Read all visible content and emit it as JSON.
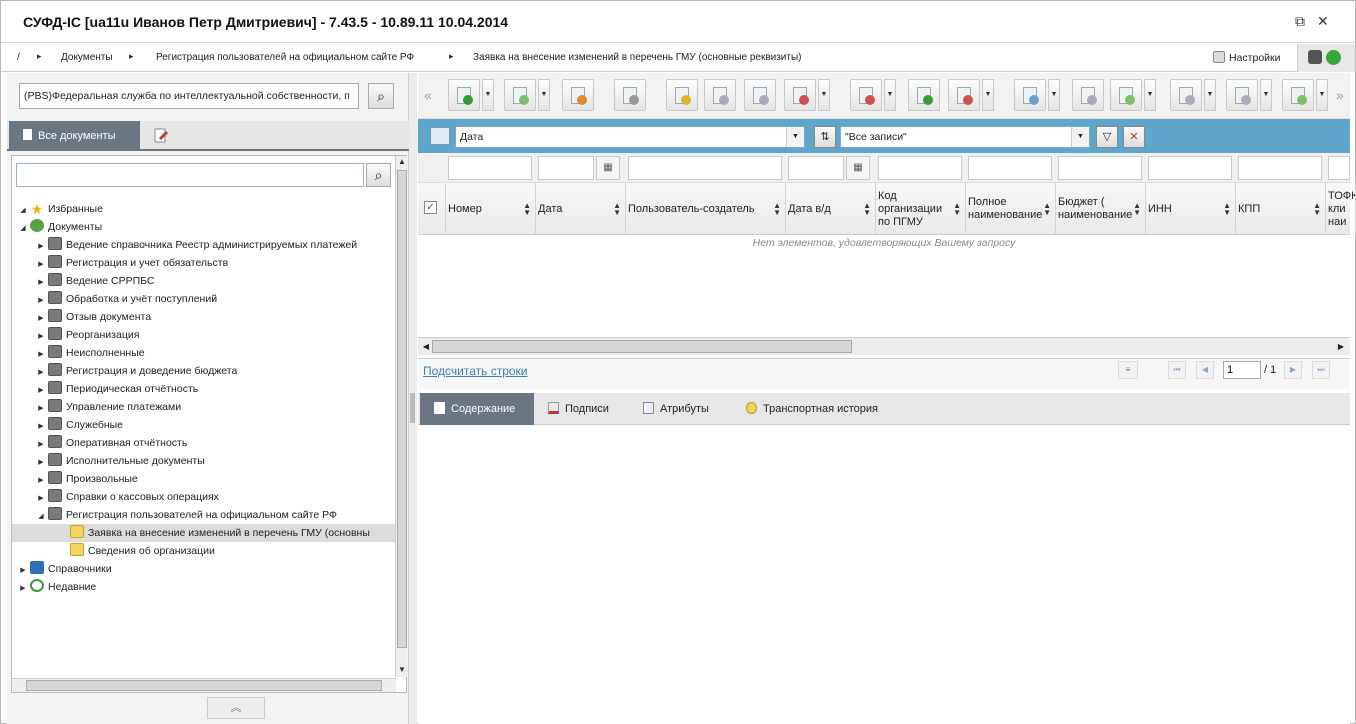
{
  "window": {
    "title": "СУФД-IC [ua11u Иванов Петр Дмитриевич] - 7.43.5 - 10.89.11 10.04.2014",
    "restore_icon": "restore-icon",
    "close_icon": "close-icon"
  },
  "breadcrumb": {
    "root": "/",
    "items": [
      "Документы",
      "Регистрация пользователей на официальном сайте РФ",
      "Заявка на внесение изменений в перечень ГМУ (основные реквизиты)"
    ],
    "settings_label": "Настройки"
  },
  "left_panel": {
    "org_value": "(PBS)Федеральная служба по интеллектуальной собственности, п",
    "tabs": {
      "all_docs": "Все документы"
    },
    "tree": {
      "favorites": "Избранные",
      "documents": "Документы",
      "doc_items": [
        "Ведение справочника Реестр администрируемых платежей",
        "Регистрация и учет обязательств",
        "Ведение СРРПБС",
        "Обработка и учёт поступлений",
        "Отзыв документа",
        "Реорганизация",
        "Неисполненные",
        "Регистрация и доведение бюджета",
        "Периодическая отчётность",
        "Управление платежами",
        "Служебные",
        "Оперативная отчётность",
        "Исполнительные документы",
        "Произвольные",
        "Справки о кассовых операциях",
        "Регистрация пользователей на официальном сайте РФ"
      ],
      "sub_items": [
        "Заявка на внесение изменений в перечень ГМУ (основны",
        "Сведения об организации"
      ],
      "directories": "Справочники",
      "recent": "Недавние"
    }
  },
  "filter": {
    "field": "Дата",
    "records": "\"Все записи\""
  },
  "grid": {
    "columns": [
      "Номер",
      "Дата",
      "Пользователь-создатель",
      "Дата в/д",
      "Код организации по ПГМУ",
      "Полное наименование",
      "Бюджет ( наименование",
      "ИНН",
      "КПП",
      "ТОФК кли наи"
    ],
    "empty_message": "Нет элементов, удовлетворяющих Вашему запросу"
  },
  "pager": {
    "count_link": "Подсчитать строки",
    "page": "1",
    "total": "/ 1"
  },
  "bottom_tabs": [
    "Содержание",
    "Подписи",
    "Атрибуты",
    "Транспортная история"
  ],
  "colors": {
    "accent": "#5fa6cd",
    "tab_active": "#6b7683",
    "link": "#3a7fb8"
  }
}
